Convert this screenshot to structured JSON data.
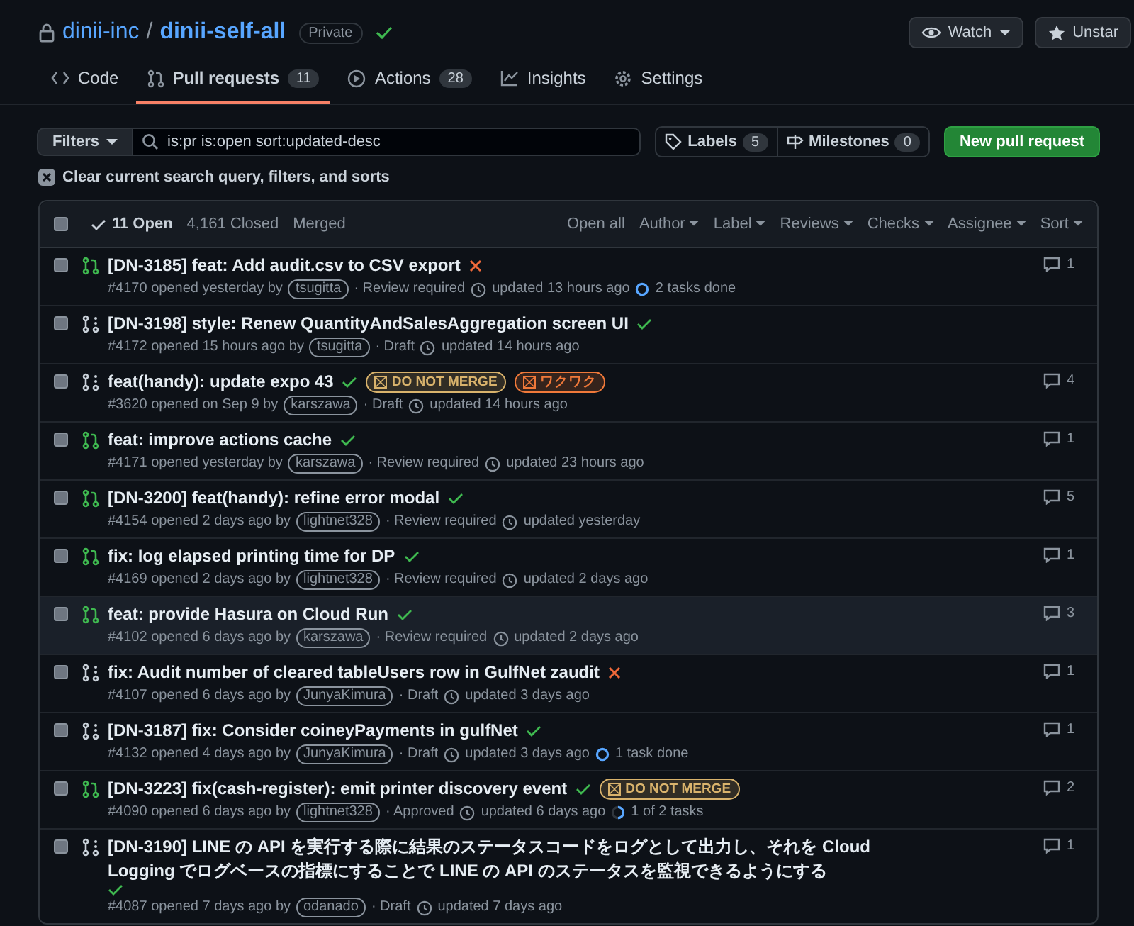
{
  "repo": {
    "owner": "dinii-inc",
    "separator": "/",
    "name": "dinii-self-all",
    "visibility": "Private",
    "verified": true
  },
  "actions": [
    {
      "label": "Watch"
    },
    {
      "label": "Unstar"
    }
  ],
  "tabs": [
    {
      "label": "Code",
      "selected": false
    },
    {
      "label": "Pull requests",
      "count": "11",
      "selected": true
    },
    {
      "label": "Actions",
      "count": "28",
      "selected": false
    },
    {
      "label": "Insights",
      "selected": false
    },
    {
      "label": "Settings",
      "selected": false
    }
  ],
  "search": {
    "filters": "Filters",
    "value": "is:pr is:open sort:updated-desc"
  },
  "labels_button": {
    "label": "Labels",
    "count": "5"
  },
  "milestones_button": {
    "label": "Milestones",
    "count": "0"
  },
  "new_button": "New pull request",
  "clear_filters": "Clear current search query, filters, and sorts",
  "list_header": {
    "select_all_checked": false,
    "states": [
      {
        "label": "11 Open",
        "selected": true
      },
      {
        "label": "4,161 Closed",
        "selected": false
      },
      {
        "label": "Merged",
        "selected": false
      }
    ],
    "open_all": "Open all",
    "menus": [
      "Author",
      "Label",
      "Reviews",
      "Checks",
      "Assignee",
      "Sort"
    ]
  },
  "rows": [
    {
      "kind": "open",
      "title": "[DN-3185] feat: Add audit.csv to CSV export",
      "checks_passed": false,
      "labels": [],
      "number": "#4170",
      "opened": "opened yesterday by",
      "author": "tsugitta",
      "review": "· Review required",
      "updated": "updated 13 hours ago",
      "tasks": {
        "text": "2 tasks done",
        "complete": true
      },
      "comments": "1",
      "highlighted": false
    },
    {
      "kind": "draft",
      "title": "[DN-3198] style: Renew QuantityAndSalesAggregation screen UI",
      "checks_passed": true,
      "labels": [],
      "number": "#4172",
      "opened": "opened 15 hours ago by",
      "author": "tsugitta",
      "review": "· Draft",
      "updated": "updated 14 hours ago",
      "highlighted": false
    },
    {
      "kind": "draft",
      "title": "feat(handy): update expo 43",
      "checks_passed": true,
      "labels": [
        {
          "name": "DO NOT MERGE",
          "color": "#d9b36c"
        },
        {
          "name": "ワクワク",
          "color": "#f0793a"
        }
      ],
      "number": "#3620",
      "opened": "opened on Sep 9 by",
      "author": "karszawa",
      "review": "· Draft",
      "updated": "updated 14 hours ago",
      "comments": "4",
      "highlighted": false
    },
    {
      "kind": "open",
      "title": "feat: improve actions cache",
      "checks_passed": true,
      "labels": [],
      "number": "#4171",
      "opened": "opened yesterday by",
      "author": "karszawa",
      "review": "· Review required",
      "updated": "updated 23 hours ago",
      "comments": "1",
      "highlighted": false
    },
    {
      "kind": "open",
      "title": "[DN-3200] feat(handy): refine error modal",
      "checks_passed": true,
      "labels": [],
      "number": "#4154",
      "opened": "opened 2 days ago by",
      "author": "lightnet328",
      "review": "· Review required",
      "updated": "updated yesterday",
      "comments": "5",
      "highlighted": false
    },
    {
      "kind": "open",
      "title": "fix: log elapsed printing time for DP",
      "checks_passed": true,
      "labels": [],
      "number": "#4169",
      "opened": "opened 2 days ago by",
      "author": "lightnet328",
      "review": "· Review required",
      "updated": "updated 2 days ago",
      "comments": "1",
      "highlighted": false
    },
    {
      "kind": "open",
      "title": "feat: provide Hasura on Cloud Run",
      "checks_passed": true,
      "labels": [],
      "number": "#4102",
      "opened": "opened 6 days ago by",
      "author": "karszawa",
      "review": "· Review required",
      "updated": "updated 2 days ago",
      "comments": "3",
      "highlighted": true
    },
    {
      "kind": "draft",
      "title": "fix: Audit number of cleared tableUsers row in GulfNet zaudit",
      "checks_passed": false,
      "labels": [],
      "number": "#4107",
      "opened": "opened 6 days ago by",
      "author": "JunyaKimura",
      "review": "· Draft",
      "updated": "updated 3 days ago",
      "comments": "1",
      "highlighted": false
    },
    {
      "kind": "draft",
      "title": "[DN-3187] fix: Consider coineyPayments in gulfNet",
      "checks_passed": true,
      "labels": [],
      "number": "#4132",
      "opened": "opened 4 days ago by",
      "author": "JunyaKimura",
      "review": "· Draft",
      "updated": "updated 3 days ago",
      "tasks": {
        "text": "1 task done",
        "complete": true
      },
      "comments": "1",
      "highlighted": false
    },
    {
      "kind": "open",
      "title": "[DN-3223] fix(cash-register): emit printer discovery event",
      "checks_passed": true,
      "labels": [
        {
          "name": "DO NOT MERGE",
          "color": "#d9b36c"
        }
      ],
      "number": "#4090",
      "opened": "opened 6 days ago by",
      "author": "lightnet328",
      "review": "· Approved",
      "updated": "updated 6 days ago",
      "tasks": {
        "text": "1 of 2 tasks",
        "complete": false
      },
      "comments": "2",
      "highlighted": false
    },
    {
      "kind": "draft",
      "title": "[DN-3190] LINE の API を実行する際に結果のステータスコードをログとして出力し、それを Cloud Logging でログベースの指標にすることで LINE の API のステータスを監視できるようにする",
      "checks_passed": true,
      "labels": [],
      "number": "#4087",
      "opened": "opened 7 days ago by",
      "author": "odanado",
      "review": "· Draft",
      "updated": "updated 7 days ago",
      "comments": "1",
      "highlighted": false
    }
  ]
}
